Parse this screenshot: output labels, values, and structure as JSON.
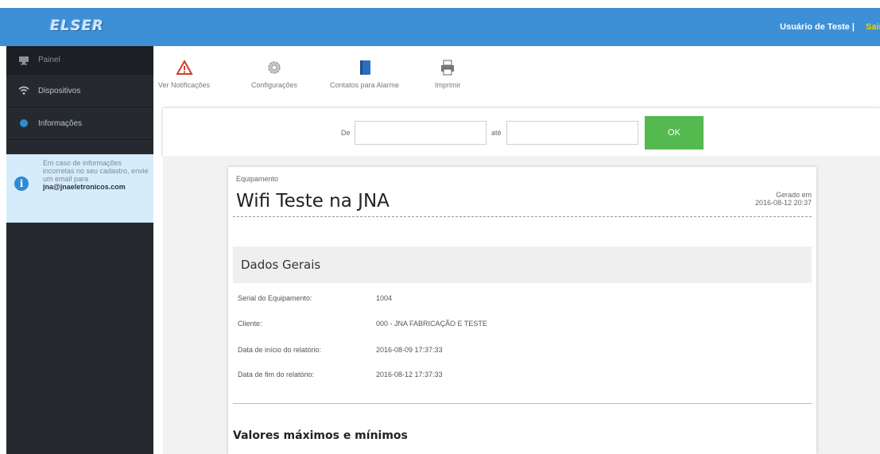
{
  "header": {
    "logo_text": "ELSER",
    "user": "Usuário de Teste",
    "user_suffix": "|",
    "logout": "Sair",
    "bar_color": "#3d8fd6"
  },
  "sidebar": {
    "items": [
      {
        "label": "Painel",
        "icon": "monitor-icon"
      },
      {
        "label": "Dispositivos",
        "icon": "wifi-icon"
      },
      {
        "label": "Informações",
        "icon": "info-dot-icon"
      }
    ],
    "info": {
      "text": "Em caso de informações incorretas no seu cadastro, envie um email para",
      "email": "jna@jnaeletronicos.com"
    }
  },
  "toolbar": {
    "items": [
      {
        "label": "Ver Notificações",
        "icon": "warning-icon"
      },
      {
        "label": "Configurações",
        "icon": "gear-icon"
      },
      {
        "label": "Contatos para Alarme",
        "icon": "book-icon"
      },
      {
        "label": "Imprimir",
        "icon": "printer-icon"
      }
    ]
  },
  "filter": {
    "from_label": "De",
    "to_label": "até",
    "from_value": "",
    "to_value": "",
    "ok_label": "OK",
    "ok_color": "#54b94e"
  },
  "report": {
    "equipment_label": "Equipamento",
    "title": "Wifi Teste na JNA",
    "generated_label": "Gerado em",
    "generated_at": "2016-08-12 20:37",
    "section_title": "Dados Gerais",
    "rows": [
      {
        "key": "Serial do Equipamento:",
        "value": "1004"
      },
      {
        "key": "Cliente:",
        "value": "000 - JNA FABRICAÇÃO E TESTE"
      },
      {
        "key": "Data de início do relatório:",
        "value": "2016-08-09 17:37:33"
      },
      {
        "key": "Data de fim do relatório:",
        "value": "2016-08-12 17:37:33"
      }
    ],
    "minmax_title": "Valores máximos e mínimos"
  }
}
